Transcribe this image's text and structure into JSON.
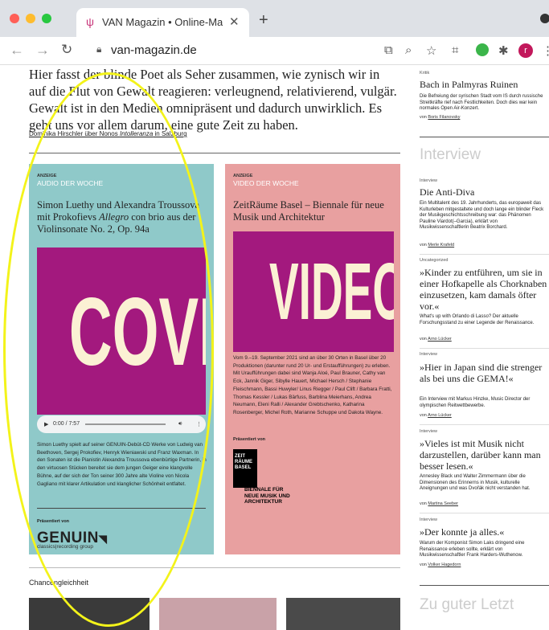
{
  "browser": {
    "tab_title": "VAN Magazin • Online-Magazin",
    "url": "van-magazin.de",
    "avatar_letter": "r"
  },
  "article": {
    "intro": "Hier fasst der blinde Poet als Seher zusammen, wie zynisch wir in auf die Flut von Gewalt reagieren: verleugnend, relativierend, vulgär. Gewalt ist in den Medien omnipräsent und dadurch unwirklich. Es geht uns vor allem darum, eine gute Zeit zu haben.",
    "byline_pre": "Dominika Hirschler über Nonos ",
    "byline_work": "Intolleranza",
    "byline_post": " in Salzburg"
  },
  "ad_cover": {
    "label": "ANZEIGE",
    "kicker": "AUDIO DER WOCHE",
    "title_a": "Simon Luethy und Alexandra Troussova mit Prokofievs ",
    "title_b": "Allegro",
    "title_c": " con brio aus der Violinsonate No. 2, Op. 94a",
    "big_word": "COVER",
    "player_time": "0:00 / 7:57",
    "body": "Simon Luethy spielt auf seiner GENUIN-Debüt-CD Werke von Ludwig van Beethoven, Sergej Prokofiev, Henryk Wieniawski und Franz Waxman. In den Sonaten ist die Pianistin Alexandra Troussova ebenbürtige Partnerin, in den virtuosen Stücken bereitet sie dem jungen Geiger eine klangvolle Bühne, auf der sich der Ton seiner 300 Jahre alte Violine von Nicola Gagliano mit klarer Artikulation und klanglicher Schönheit entfaltet.",
    "presented": "Präsentiert von",
    "sponsor": "GENUIN",
    "sponsor_sub": "classics|recording group"
  },
  "ad_video": {
    "label": "ANZEIGE",
    "kicker": "VIDEO DER WOCHE",
    "title": "ZeitRäume Basel – Biennale für neue Musik und Architektur",
    "big_word": "VIDEO",
    "body": "Vom 9.–19. September 2021 sind an über 30 Orten in Basel über 20 Produktionen (darunter rund 20 Ur- und Erstaufführungen) zu erleben. Mit Uraufführungen dabei sind Wanja Aloé, Paul Brauner, Cathy van Eck, Jannik Giger, Sibylle Hauert, Michael Hersch / Stephanie Fleischmann, Bassi Huwyler/ Linus Riegger / Paul Clift / Barbara Fratti, Thomas Kessler / Lukas Bärfuss, Barblina Meierhans, Andrea Neumann, Eleni Ralli / Alexander Grebtschenko, Katharina Rosenberger, Michel Roth, Marianne Schuppe und Dakota Wayne.",
    "presented": "Präsentiert von",
    "logo_text": "ZEIT RÄUME BASEL",
    "sponsor_lines": [
      "BIENNALE FÜR",
      "NEUE MUSIK UND",
      "ARCHITEKTUR"
    ]
  },
  "section_title": "Chancengleichheit",
  "sidebar": {
    "top": {
      "kicker": "Kritik",
      "title": "Bach in Palmyras Ruinen",
      "desc": "Die Befreiung der syrischen Stadt vom IS durch russische Streitkräfte rief nach Festlichkeiten. Doch dies war kein normales Open Air-Konzert.",
      "by_pre": "von ",
      "author": "Boris Filanovsky"
    },
    "heading": "Interview",
    "items": [
      {
        "kicker": "Interview",
        "title": "Die Anti-Diva",
        "desc": "Ein Multitalent des 19. Jahrhunderts, das europaweit das Kulturleben mitgestaltete und doch lange ein blinder Fleck der Musikgeschichtsschreibung war: das Phänomen Pauline Viardot(–Garcia), erklärt von Musikwissenschaftlerin Beatrix Borchard.",
        "author": "Merle Krafeld"
      },
      {
        "kicker": "Uncategorized",
        "title": "»Kinder zu entführen, um sie in einer Hofkapelle als Chorknaben einzusetzen, kam damals öfter vor.«",
        "desc": "What's up with Orlando di Lasso? Der aktuelle Forschungsstand zu einer Legende der Renaissance.",
        "author": "Arno Lücker"
      },
      {
        "kicker": "Interview",
        "title": "»Hier in Japan sind die strenger als bei uns die GEMA!«",
        "desc": "Ein Interview mit Markus Hinzke, Music Director der olympischen Reitwettbewerbe.",
        "author": "Arno Lücker"
      },
      {
        "kicker": "Interview",
        "title": "»Vieles ist mit Musik nicht darzustellen, darüber kann man besser lesen.«",
        "desc": "Annesley Black und Walter Zimmermann über die Dimensionen des Erinnerns in Musik, kulturelle Aneignungen und was Dvořák nicht verstanden hat.",
        "author": "Martina Seeber"
      },
      {
        "kicker": "Interview",
        "title": "»Der konnte ja alles.«",
        "desc": "Warum der Komponist Simon Laks dringend eine Renaissance erleben sollte, erklärt von Musikwissenschaftler Frank Harders-Wuthenow.",
        "author": "Volker Hagedorn"
      }
    ],
    "by_pre": "von ",
    "heading2": "Zu guter Letzt"
  },
  "colors": {
    "cover_bg": "#8fc9c9",
    "video_bg": "#e8a0a0",
    "magenta": "#a3197e",
    "cream": "#fbf1d4",
    "highlight": "#f3f31a"
  }
}
